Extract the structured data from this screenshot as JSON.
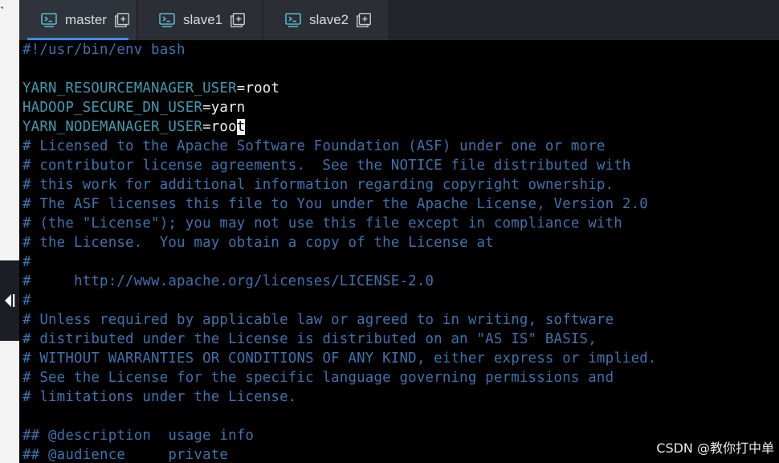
{
  "tabs": [
    {
      "label": "master",
      "active": true
    },
    {
      "label": "slave1",
      "active": false
    },
    {
      "label": "slave2",
      "active": false
    }
  ],
  "terminal": {
    "shebang": "#!/usr/bin/env bash",
    "env_lines": [
      {
        "name": "YARN_RESOURCEMANAGER_USER",
        "op": "=",
        "value": "root"
      },
      {
        "name": "HADOOP_SECURE_DN_USER",
        "op": "=",
        "value": "yarn"
      },
      {
        "name": "YARN_NODEMANAGER_USER",
        "op": "=",
        "value_before_cursor": "roo",
        "cursor_char": "t"
      }
    ],
    "comments": [
      "# Licensed to the Apache Software Foundation (ASF) under one or more",
      "# contributor license agreements.  See the NOTICE file distributed with",
      "# this work for additional information regarding copyright ownership.",
      "# The ASF licenses this file to You under the Apache License, Version 2.0",
      "# (the \"License\"); you may not use this file except in compliance with",
      "# the License.  You may obtain a copy of the License at",
      "#",
      "#     http://www.apache.org/licenses/LICENSE-2.0",
      "#",
      "# Unless required by applicable law or agreed to in writing, software",
      "# distributed under the License is distributed on an \"AS IS\" BASIS,",
      "# WITHOUT WARRANTIES OR CONDITIONS OF ANY KIND, either express or implied.",
      "# See the License for the specific language governing permissions and",
      "# limitations under the License."
    ],
    "doc_lines": [
      "## @description  usage info",
      "## @audience     private"
    ]
  },
  "watermark": "CSDN @教你打中单",
  "colors": {
    "comment": "#3f72ad",
    "variable": "#3f9bb0",
    "value": "#f0f0f0",
    "tab_accent": "#3c8ee6",
    "icon_teal": "#5fb6cc"
  }
}
